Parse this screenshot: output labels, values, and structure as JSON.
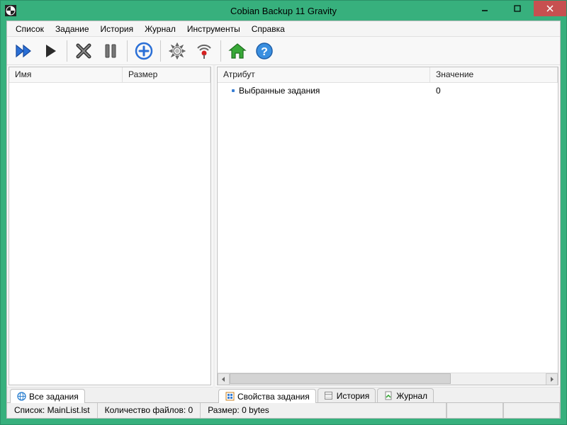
{
  "window": {
    "title": "Cobian Backup 11 Gravity"
  },
  "menu": {
    "items": [
      "Список",
      "Задание",
      "История",
      "Журнал",
      "Инструменты",
      "Справка"
    ]
  },
  "left_panel": {
    "columns": [
      "Имя",
      "Размер"
    ]
  },
  "right_panel": {
    "columns": [
      "Атрибут",
      "Значение"
    ],
    "rows": [
      {
        "attr": "Выбранные задания",
        "val": "0"
      }
    ]
  },
  "left_tabs": [
    {
      "label": "Все задания",
      "icon": "globe-icon"
    }
  ],
  "right_tabs": [
    {
      "label": "Свойства задания",
      "icon": "properties-icon"
    },
    {
      "label": "История",
      "icon": "history-icon"
    },
    {
      "label": "Журнал",
      "icon": "log-icon"
    }
  ],
  "status": {
    "list": "Список: MainList.lst",
    "file_count": "Количество файлов: 0",
    "size": "Размер: 0 bytes"
  }
}
